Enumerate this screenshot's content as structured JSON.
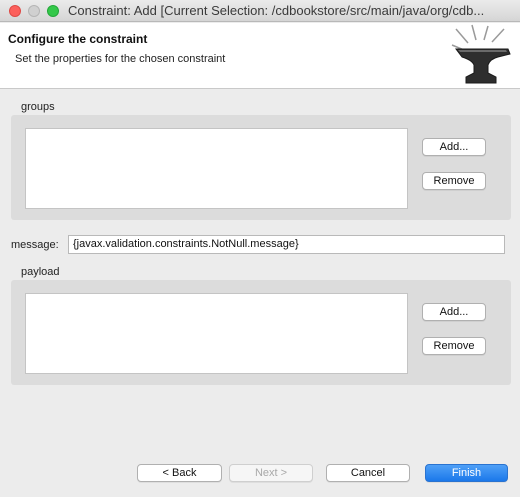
{
  "window": {
    "title": "Constraint: Add [Current Selection: /cdbookstore/src/main/java/org/cdb..."
  },
  "header": {
    "title": "Configure the constraint",
    "description": "Set the properties for the chosen constraint",
    "icon": "anvil-icon"
  },
  "groups": {
    "label": "groups",
    "add_label": "Add...",
    "remove_label": "Remove",
    "items": []
  },
  "message": {
    "label": "message:",
    "value": "{javax.validation.constraints.NotNull.message}"
  },
  "payload": {
    "label": "payload",
    "add_label": "Add...",
    "remove_label": "Remove",
    "items": []
  },
  "footer": {
    "back_label": "< Back",
    "next_label": "Next >",
    "cancel_label": "Cancel",
    "finish_label": "Finish"
  },
  "colors": {
    "accent": "#1b78ea",
    "background": "#ececec",
    "group_background": "#dcdcdc"
  }
}
